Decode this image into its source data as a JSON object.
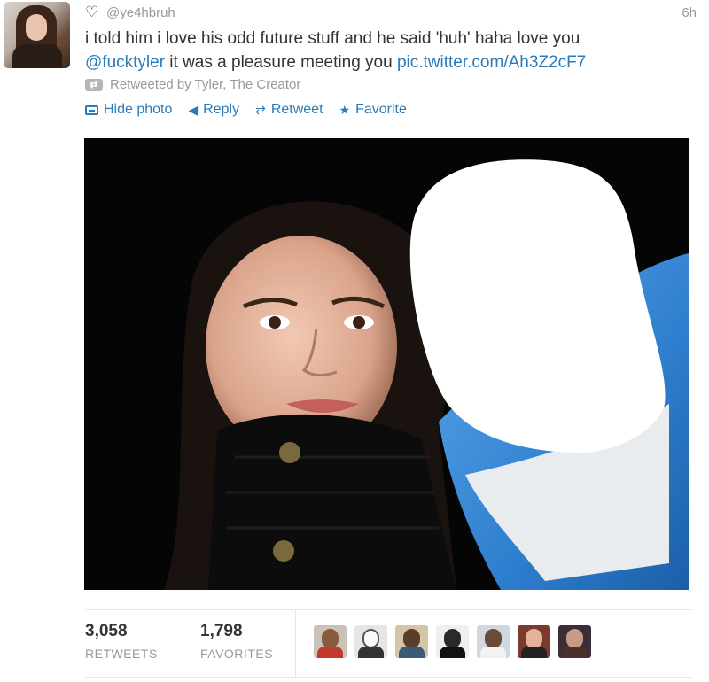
{
  "tweet": {
    "handle": "@ye4hbruh",
    "time": "6h",
    "text_part1": "i told him i love his odd future stuff and he said 'huh' haha love you",
    "mention": "@fucktyler",
    "text_part2": " it was a pleasure meeting you ",
    "link": "pic.twitter.com/Ah3Z2cF7",
    "retweeted_by": "Retweeted by Tyler, The Creator"
  },
  "actions": {
    "hide_photo": "Hide photo",
    "reply": "Reply",
    "retweet": "Retweet",
    "favorite": "Favorite"
  },
  "stats": {
    "retweets_count": "3,058",
    "retweets_label": "RETWEETS",
    "favorites_count": "1,798",
    "favorites_label": "FAVORITES"
  },
  "icons": {
    "heart": "heart-icon",
    "retweeted": "retweet-icon",
    "photo": "photo-icon",
    "reply": "reply-icon",
    "retweet": "retweet-icon",
    "favorite": "star-icon"
  },
  "colors": {
    "link": "#2b7bb9",
    "muted": "#999999",
    "text": "#333333"
  }
}
